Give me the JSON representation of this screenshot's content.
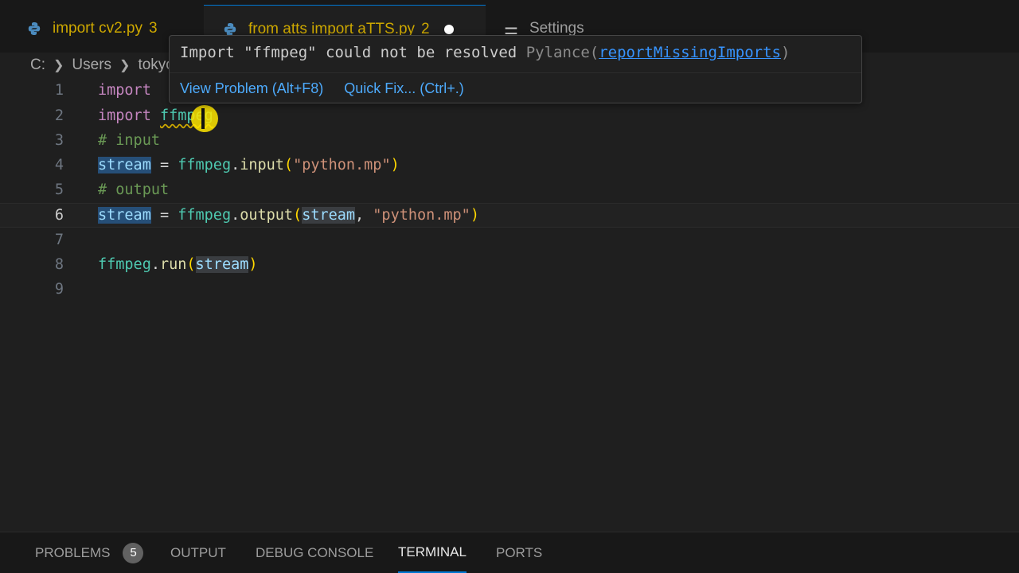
{
  "tabs": [
    {
      "label": "import cv2.py",
      "problems": "3",
      "icon": "python-icon",
      "color": "#cca700"
    },
    {
      "label": "from atts import aTTS.py",
      "problems": "2",
      "icon": "python-icon",
      "modified": true,
      "color": "#cca700"
    },
    {
      "label": "Settings",
      "icon": "settings-icon"
    }
  ],
  "breadcrumb": [
    "C:",
    "Users",
    "tokyo"
  ],
  "editor": {
    "lines": [
      {
        "number": "1",
        "tokens": [
          "import",
          ""
        ]
      },
      {
        "number": "2",
        "tokens": [
          "import",
          "ffmpeg"
        ]
      },
      {
        "number": "3",
        "tokens": [
          "# input"
        ]
      },
      {
        "number": "4",
        "tokens": [
          "stream",
          "=",
          "ffmpeg",
          ".",
          "input",
          "(",
          "\"python.mp\"",
          ")"
        ]
      },
      {
        "number": "5",
        "tokens": [
          "# output"
        ]
      },
      {
        "number": "6",
        "tokens": [
          "stream",
          "=",
          "ffmpeg",
          ".",
          "output",
          "(",
          "stream",
          ",",
          "\"python.mp\"",
          ")"
        ]
      },
      {
        "number": "7",
        "tokens": []
      },
      {
        "number": "8",
        "tokens": [
          "ffmpeg",
          ".",
          "run",
          "(",
          "stream",
          ")"
        ]
      },
      {
        "number": "9",
        "tokens": []
      }
    ]
  },
  "hover": {
    "message": "Import \"ffmpeg\" could not be resolved",
    "source": "Pylance(",
    "rule": "reportMissingImports",
    "source_close": ")",
    "actions": [
      "View Problem (Alt+F8)",
      "Quick Fix... (Ctrl+.)"
    ]
  },
  "panel": {
    "tabs": [
      {
        "label": "PROBLEMS",
        "badge": "5"
      },
      {
        "label": "OUTPUT"
      },
      {
        "label": "DEBUG CONSOLE"
      },
      {
        "label": "TERMINAL",
        "active": true
      },
      {
        "label": "PORTS"
      }
    ]
  },
  "colors": {
    "accent": "#0078d4",
    "warning": "#cca700",
    "link": "#3794ff"
  }
}
